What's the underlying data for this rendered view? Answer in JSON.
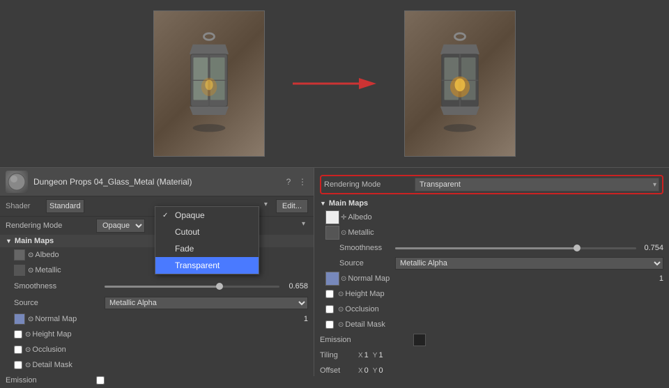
{
  "previews": {
    "left_alt": "Lantern before - opaque",
    "right_alt": "Lantern after - transparent",
    "arrow_label": "→"
  },
  "inspector": {
    "title": "Dungeon Props 04_Glass_Metal (Material)",
    "help_icon": "?",
    "menu_icon": "⋮",
    "shader_label": "Shader",
    "shader_value": "Standard",
    "edit_label": "Edit...",
    "rendering_mode_label": "Rendering Mode",
    "rendering_mode_value": "Opaque",
    "main_maps_label": "Main Maps",
    "albedo_label": "Albedo",
    "metallic_label": "Metallic",
    "smoothness_label": "Smoothness",
    "smoothness_value": "0.658",
    "source_label": "Source",
    "source_value": "Metallic Alpha",
    "normal_map_label": "Normal Map",
    "normal_map_value": "1",
    "height_map_label": "Height Map",
    "occlusion_label": "Occlusion",
    "detail_mask_label": "Detail Mask",
    "emission_label": "Emission"
  },
  "dropdown": {
    "items": [
      {
        "label": "Opaque",
        "selected": false
      },
      {
        "label": "Cutout",
        "selected": false
      },
      {
        "label": "Fade",
        "selected": false
      },
      {
        "label": "Transparent",
        "selected": true
      }
    ]
  },
  "right_panel": {
    "rendering_mode_label": "Rendering Mode",
    "rendering_mode_value": "Transparent",
    "main_maps_label": "Main Maps",
    "albedo_label": "Albedo",
    "metallic_label": "Metallic",
    "smoothness_label": "Smoothness",
    "smoothness_value": "0.754",
    "source_label": "Source",
    "source_value": "Metallic Alpha",
    "normal_map_label": "Normal Map",
    "normal_map_value": "1",
    "height_map_label": "Height Map",
    "occlusion_label": "Occlusion",
    "detail_mask_label": "Detail Mask",
    "emission_label": "Emission",
    "tiling_label": "Tiling",
    "tiling_x_label": "X",
    "tiling_x_value": "1",
    "tiling_y_label": "Y",
    "tiling_y_value": "1",
    "offset_label": "Offset",
    "offset_x_label": "X",
    "offset_x_value": "0",
    "offset_y_label": "Y",
    "offset_y_value": "0"
  }
}
